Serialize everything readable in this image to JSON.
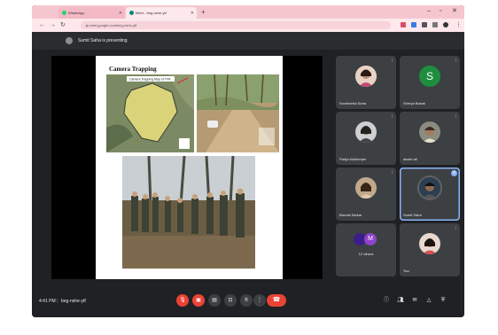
{
  "browser": {
    "tabs": [
      {
        "label": "WhatsApp"
      },
      {
        "label": "Meet - beg-nshe-ytf"
      }
    ],
    "url": "meet.google.com/beg-nshe-ytf"
  },
  "meet": {
    "presenting_text": "Sumit Saha is presenting",
    "slide_title": "Camera Trapping",
    "map_caption": "Camera Trapping Map of TFR",
    "participants": [
      {
        "name": "Suchismita Saha"
      },
      {
        "name": "Shreya Basak",
        "initial": "S"
      },
      {
        "name": "Partja Mukherjee"
      },
      {
        "name": "akash ali"
      },
      {
        "name": "Barnali Sarkar"
      },
      {
        "name": "Sumit Saha"
      },
      {
        "name": "12 others",
        "initial": "M"
      },
      {
        "name": "You"
      }
    ],
    "time": "4:41 PM",
    "separator": "|",
    "meeting_code": "beg-nshe-ytf"
  },
  "icons": [
    "whatsapp-icon",
    "meet-icon",
    "close-icon",
    "plus-icon",
    "back-icon",
    "forward-icon",
    "reload-icon",
    "lock-icon",
    "mic-off-icon",
    "camera-off-icon",
    "captions-icon",
    "present-icon",
    "raise-hand-icon",
    "more-icon",
    "end-call-icon",
    "info-icon",
    "people-icon",
    "chat-icon",
    "activities-icon",
    "host-controls-icon"
  ],
  "colors": {
    "red": "#ea4335",
    "meet_bg": "#202124",
    "tile": "#3c4043",
    "accent": "#8ab4f8"
  }
}
